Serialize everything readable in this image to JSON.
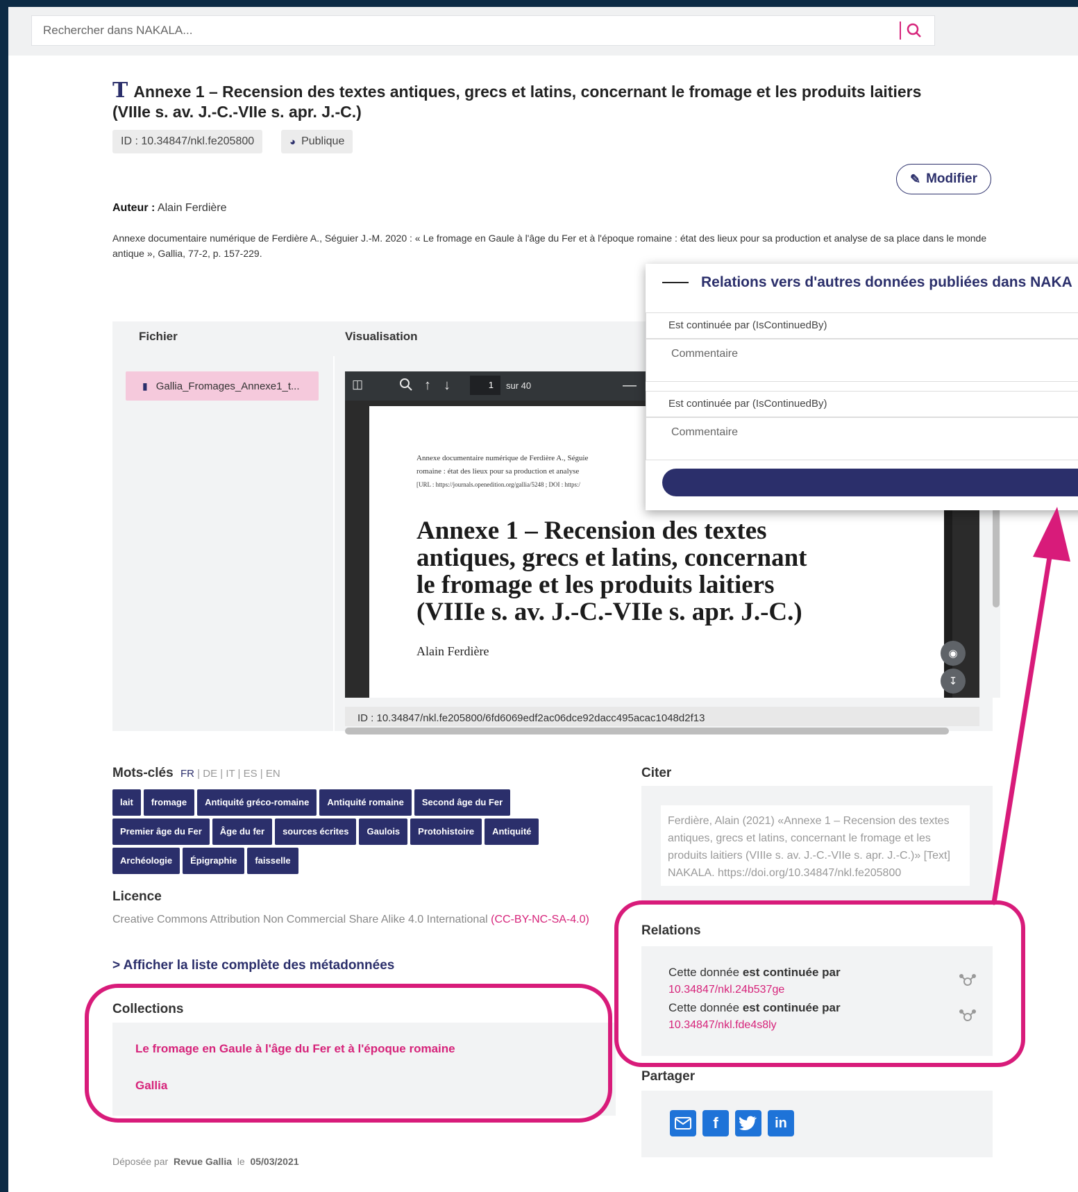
{
  "search": {
    "placeholder": "Rechercher dans NAKALA..."
  },
  "header": {
    "title_line1": "Annexe 1 – Recension des textes antiques, grecs et latins, concernant le fromage et les produits laitiers",
    "title_line2": "(VIIIe s. av. J.-C.-VIIe s. apr. J.-C.)",
    "id_label": "ID : 10.34847/nkl.fe205800",
    "visibility": "Publique",
    "modify_label": "Modifier"
  },
  "meta": {
    "author_label": "Auteur :",
    "author": "Alain Ferdière",
    "description": "Annexe documentaire numérique de Ferdière A., Séguier J.-M. 2020 : « Le fromage en Gaule à l'âge du Fer et à l'époque romaine : état des lieux pour sa production et analyse de sa place dans le monde antique », Gallia, 77-2, p. 157-229."
  },
  "files": {
    "col_file": "Fichier",
    "col_view": "Visualisation",
    "file_name": "Gallia_Fromages_Annexe1_t...",
    "viewer": {
      "page": "1",
      "total": "sur 40",
      "ref_line1": "Annexe documentaire numérique de Ferdière A., Séguie",
      "ref_line2": "romaine : état des lieux pour sa production et analyse",
      "ref_line3": "[URL : https://journals.openedition.org/gallia/5248 ; DOI : https:/",
      "pdf_title_1": "Annexe 1 – Recension des textes",
      "pdf_title_2": "antiques, grecs et latins, concernant",
      "pdf_title_3": "le fromage et les produits laitiers",
      "pdf_title_4": "(VIIIe s. av. J.-C.-VIIe s. apr. J.-C.)",
      "pdf_author": "Alain Ferdière"
    },
    "file_id": "ID : 10.34847/nkl.fe205800/6fd6069edf2ac06dce92dacc495acac1048d2f13"
  },
  "relations_popup": {
    "title": "Relations vers d'autres données publiées dans NAKA",
    "rows": [
      {
        "type": "Est continuée par (IsContinuedBy)",
        "comment_placeholder": "Commentaire"
      },
      {
        "type": "Est continuée par (IsContinuedBy)",
        "comment_placeholder": "Commentaire"
      }
    ]
  },
  "keywords": {
    "heading": "Mots-clés",
    "langs": [
      "FR",
      "DE",
      "IT",
      "ES",
      "EN"
    ],
    "active_lang": "FR",
    "tags": [
      "lait",
      "fromage",
      "Antiquité gréco-romaine",
      "Antiquité romaine",
      "Second âge du Fer",
      "Premier âge du Fer",
      "Âge du fer",
      "sources écrites",
      "Gaulois",
      "Protohistoire",
      "Antiquité",
      "Archéologie",
      "Épigraphie",
      "faisselle"
    ]
  },
  "licence": {
    "heading": "Licence",
    "text": "Creative Commons Attribution Non Commercial Share Alike 4.0 International",
    "code": "(CC-BY-NC-SA-4.0)"
  },
  "metadata_link": "> Afficher la liste complète des métadonnées",
  "collections": {
    "heading": "Collections",
    "items": [
      "Le fromage en Gaule à l'âge du Fer et à l'époque romaine",
      "Gallia"
    ]
  },
  "citer": {
    "heading": "Citer",
    "text": "Ferdière, Alain (2021) «Annexe 1 – Recension des textes antiques, grecs et latins, concernant le fromage et les produits laitiers (VIIIe s. av. J.-C.-VIIe s. apr. J.-C.)» [Text] NAKALA. https://doi.org/10.34847/nkl.fe205800"
  },
  "relations": {
    "heading": "Relations",
    "items": [
      {
        "prefix": "Cette donnée",
        "bold": "est continuée par",
        "link": "10.34847/nkl.24b537ge"
      },
      {
        "prefix": "Cette donnée",
        "bold": "est continuée par",
        "link": "10.34847/nkl.fde4s8ly"
      }
    ]
  },
  "share": {
    "heading": "Partager"
  },
  "deposit": {
    "prefix": "Déposée par",
    "by": "Revue Gallia",
    "le": "le",
    "date": "05/03/2021"
  },
  "colors": {
    "brand": "#2b2f6b",
    "accent": "#d6237a",
    "highlight": "#d81b7a",
    "frame": "#0d2b45"
  }
}
